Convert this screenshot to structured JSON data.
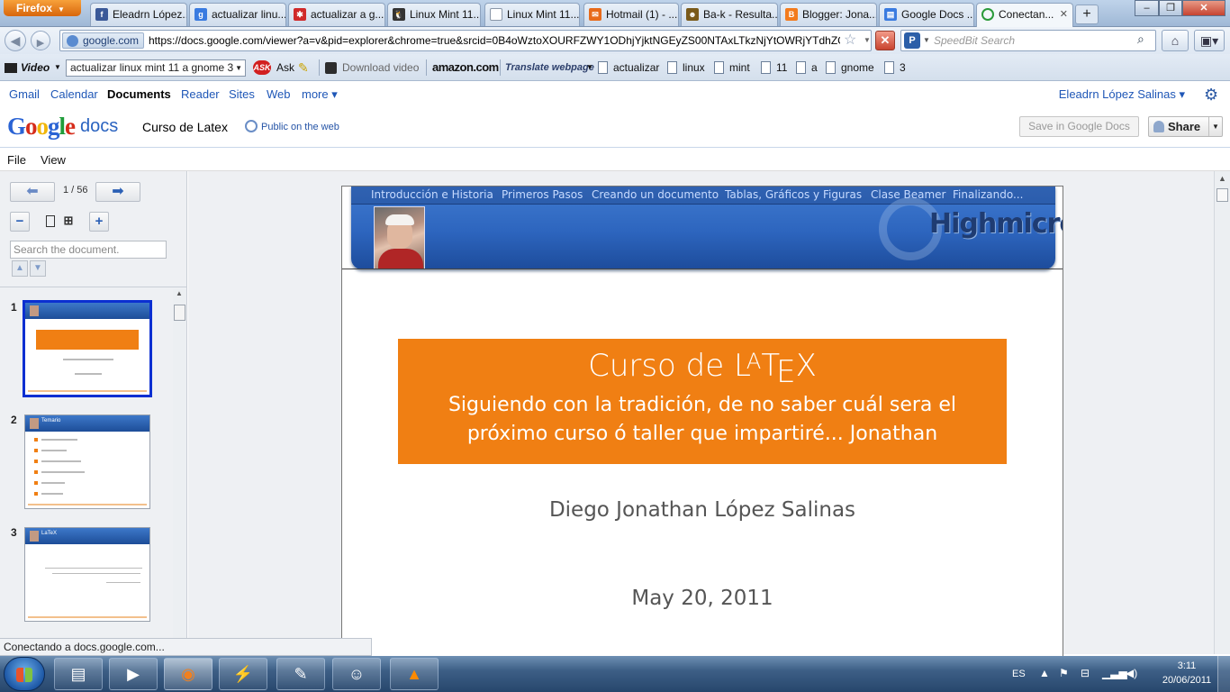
{
  "browser": {
    "menu_button": "Firefox",
    "tabs": [
      {
        "title": "Eleadrn López...",
        "favicon": "facebook",
        "color": "#3b5998"
      },
      {
        "title": "actualizar linu...",
        "favicon": "google",
        "color": "#3a7be0"
      },
      {
        "title": "actualizar a g...",
        "favicon": "dots",
        "color": "#d02a2a"
      },
      {
        "title": "Linux Mint 11...",
        "favicon": "tux",
        "color": "#333333"
      },
      {
        "title": "Linux Mint 11...",
        "favicon": "page",
        "color": "#9aa7b8"
      },
      {
        "title": "Hotmail (1) - ...",
        "favicon": "hotmail",
        "color": "#e86a1a"
      },
      {
        "title": "Ba-k - Resulta...",
        "favicon": "owl",
        "color": "#7a5a1a"
      },
      {
        "title": "Blogger: Jona...",
        "favicon": "blogger",
        "color": "#f37b1d"
      },
      {
        "title": "Google Docs ...",
        "favicon": "docs",
        "color": "#3a7be0"
      },
      {
        "title": "Conectan...",
        "favicon": "loading",
        "color": "#2a9a3a"
      }
    ],
    "new_tab_label": "+",
    "window_controls": [
      "–",
      "❐",
      "✕"
    ]
  },
  "navbar": {
    "site_identity": "google.com",
    "url": "https://docs.google.com/viewer?a=v&pid=explorer&chrome=true&srcid=0B4oWztoXOURFZWY1ODhjYjktNGEyZS00NTAxLTkzNjYtOWRjYTdhZGJ",
    "search_placeholder": "SpeedBit Search"
  },
  "bookmarks": {
    "video_label": "Video",
    "search_box_value": "actualizar linux mint 11 a gnome 3",
    "ask_label": "Ask",
    "download_video": "Download video",
    "amazon": "amazon.com",
    "translate": "Translate webpage",
    "words": [
      "actualizar",
      "linux",
      "mint",
      "11",
      "a",
      "gnome",
      "3"
    ]
  },
  "google_bar": {
    "links": [
      "Gmail",
      "Calendar",
      "Documents",
      "Reader",
      "Sites",
      "Web",
      "more ▾"
    ],
    "user": "Eleadrn López Salinas ▾"
  },
  "docs_header": {
    "logo_google": "Google",
    "logo_docs": "docs",
    "doc_title": "Curso de Latex",
    "visibility": "Public on the web",
    "save_button": "Save in Google Docs",
    "share_button": "Share"
  },
  "menu": {
    "file": "File",
    "view": "View"
  },
  "sidebar": {
    "page_counter": "1 / 56",
    "search_placeholder": "Search the document.",
    "thumbnails": [
      {
        "number": "1",
        "selected": true
      },
      {
        "number": "2",
        "selected": false,
        "heading": "Temario"
      },
      {
        "number": "3",
        "selected": false,
        "heading": "LaTeX"
      }
    ]
  },
  "slide": {
    "nav": [
      "Introducción e Historia",
      "Primeros Pasos",
      "Creando un documento",
      "Tablas, Gráficos y Figuras",
      "Clase Beamer",
      "Finalizando..."
    ],
    "logo": "Highmicro",
    "title": "Curso de LATEX",
    "subtitle": "Siguiendo con la tradición, de no saber cuál sera el próximo curso ó taller que impartiré... Jonathan",
    "author": "Diego Jonathan López Salinas",
    "date": "May 20, 2011",
    "colors": {
      "header_blue": "#2d65be",
      "title_orange": "#f07f13"
    }
  },
  "status": {
    "text": "Conectando a docs.google.com..."
  },
  "taskbar": {
    "language": "ES",
    "time": "3:11",
    "date": "20/06/2011"
  }
}
